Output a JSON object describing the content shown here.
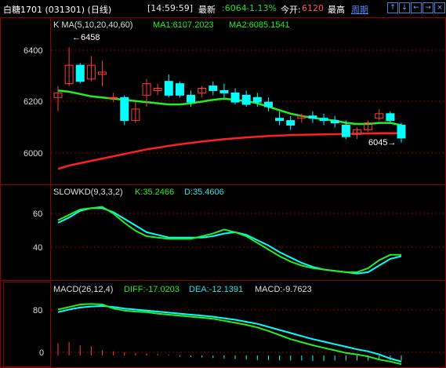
{
  "header": {
    "title": "白糖1701 (031301)  (日线)",
    "time": "[14:59:59]",
    "latest_label": "最新",
    "latest_value": ":6064",
    "change_pct": "-1.13%",
    "open_label": "今开:",
    "open_value": "6120",
    "high_label": "最高",
    "period_link": "周期",
    "nav_buttons": [
      "↑",
      "↓",
      "←",
      "→",
      "×"
    ]
  },
  "main_panel": {
    "indicator_title": "K  MA(5,10,20,40,60)",
    "ma1_text": "MA1:6107.2023",
    "ma2_text": "MA2:6085.1541",
    "y_ticks": [
      "6400",
      "6200",
      "6000"
    ],
    "high_annotation": "6458",
    "low_annotation": "6045"
  },
  "kd_panel": {
    "title": "SLOWKD(9,3,3,2)",
    "k_text": "K:35.2466",
    "d_text": "D:35.4606",
    "y_ticks": [
      "60",
      "40"
    ]
  },
  "macd_panel": {
    "title": "MACD(26,12,4)",
    "diff_text": "DIFF:-17.0203",
    "dea_text": "DEA:-12.1391",
    "macd_text": "MACD:-9.7623",
    "y_ticks": [
      "80",
      "0"
    ]
  },
  "colors": {
    "up": "#ff3c3c",
    "down": "#00ffff",
    "ma_green": "#22ee22",
    "ma_red": "#ff2020",
    "ma_magenta": "#ff22ff",
    "grid": "#8b0000",
    "axis_text": "#dddddd",
    "header_green": "#22dd22"
  },
  "chart_data": {
    "type": "candlestick",
    "candles": [
      {
        "o": 6240,
        "h": 6290,
        "l": 6180,
        "c": 6260
      },
      {
        "o": 6300,
        "h": 6458,
        "l": 6290,
        "c": 6380
      },
      {
        "o": 6380,
        "h": 6390,
        "l": 6300,
        "c": 6310
      },
      {
        "o": 6320,
        "h": 6420,
        "l": 6310,
        "c": 6380
      },
      {
        "o": 6340,
        "h": 6400,
        "l": 6290,
        "c": 6350
      },
      {
        "o": 6240,
        "h": 6260,
        "l": 6220,
        "c": 6240
      },
      {
        "o": 6240,
        "h": 6250,
        "l": 6120,
        "c": 6140
      },
      {
        "o": 6140,
        "h": 6220,
        "l": 6130,
        "c": 6190
      },
      {
        "o": 6250,
        "h": 6320,
        "l": 6200,
        "c": 6300
      },
      {
        "o": 6270,
        "h": 6300,
        "l": 6250,
        "c": 6280
      },
      {
        "o": 6310,
        "h": 6340,
        "l": 6240,
        "c": 6250
      },
      {
        "o": 6300,
        "h": 6310,
        "l": 6240,
        "c": 6250
      },
      {
        "o": 6250,
        "h": 6270,
        "l": 6200,
        "c": 6220
      },
      {
        "o": 6260,
        "h": 6290,
        "l": 6240,
        "c": 6280
      },
      {
        "o": 6290,
        "h": 6310,
        "l": 6250,
        "c": 6270
      },
      {
        "o": 6270,
        "h": 6300,
        "l": 6240,
        "c": 6260
      },
      {
        "o": 6260,
        "h": 6280,
        "l": 6210,
        "c": 6220
      },
      {
        "o": 6250,
        "h": 6270,
        "l": 6200,
        "c": 6210
      },
      {
        "o": 6240,
        "h": 6260,
        "l": 6200,
        "c": 6220
      },
      {
        "o": 6220,
        "h": 6240,
        "l": 6180,
        "c": 6200
      },
      {
        "o": 6150,
        "h": 6180,
        "l": 6120,
        "c": 6140
      },
      {
        "o": 6140,
        "h": 6160,
        "l": 6100,
        "c": 6120
      },
      {
        "o": 6150,
        "h": 6170,
        "l": 6130,
        "c": 6160
      },
      {
        "o": 6160,
        "h": 6180,
        "l": 6130,
        "c": 6150
      },
      {
        "o": 6150,
        "h": 6170,
        "l": 6120,
        "c": 6140
      },
      {
        "o": 6140,
        "h": 6160,
        "l": 6110,
        "c": 6130
      },
      {
        "o": 6120,
        "h": 6140,
        "l": 6060,
        "c": 6070
      },
      {
        "o": 6080,
        "h": 6110,
        "l": 6060,
        "c": 6100
      },
      {
        "o": 6100,
        "h": 6140,
        "l": 6090,
        "c": 6130
      },
      {
        "o": 6150,
        "h": 6190,
        "l": 6140,
        "c": 6170
      },
      {
        "o": 6170,
        "h": 6180,
        "l": 6130,
        "c": 6140
      },
      {
        "o": 6120,
        "h": 6130,
        "l": 6045,
        "c": 6064
      }
    ],
    "ma_green": [
      6270,
      6265,
      6255,
      6245,
      6240,
      6235,
      6230,
      6225,
      6220,
      6215,
      6210,
      6210,
      6215,
      6222,
      6230,
      6235,
      6230,
      6225,
      6215,
      6200,
      6185,
      6170,
      6160,
      6152,
      6145,
      6140,
      6130,
      6125,
      6125,
      6130,
      6130,
      6120
    ],
    "ma_red": [
      5930,
      5945,
      5955,
      5965,
      5975,
      5985,
      5995,
      6005,
      6015,
      6022,
      6030,
      6037,
      6043,
      6049,
      6054,
      6059,
      6063,
      6067,
      6070,
      6073,
      6075,
      6077,
      6078,
      6079,
      6080,
      6081,
      6082,
      6083,
      6084,
      6085,
      6085,
      6085
    ],
    "kd_k": [
      62,
      66,
      70,
      71,
      72,
      67,
      60,
      54,
      50,
      49,
      48,
      48,
      48,
      50,
      52,
      55,
      53,
      50,
      45,
      40,
      35,
      31,
      28,
      26,
      25,
      24,
      23,
      23,
      26,
      32,
      36,
      36
    ],
    "kd_d": [
      60,
      64,
      69,
      71,
      71,
      68,
      63,
      58,
      53,
      51,
      49,
      49,
      49,
      49,
      50,
      52,
      53,
      51,
      47,
      43,
      38,
      34,
      30,
      27,
      25,
      24,
      23,
      22,
      23,
      28,
      33,
      35
    ],
    "macd_diff": [
      90,
      95,
      100,
      101,
      100,
      92,
      88,
      86,
      85,
      82,
      80,
      78,
      76,
      74,
      72,
      68,
      64,
      60,
      55,
      48,
      40,
      32,
      26,
      20,
      15,
      10,
      5,
      2,
      -2,
      -8,
      -12,
      -17
    ],
    "macd_dea": [
      85,
      90,
      94,
      96,
      97,
      95,
      92,
      90,
      88,
      86,
      84,
      82,
      80,
      78,
      76,
      73,
      70,
      66,
      62,
      56,
      50,
      44,
      38,
      32,
      27,
      22,
      17,
      12,
      8,
      2,
      -6,
      -12
    ],
    "macd_hist": [
      24,
      26,
      20,
      18,
      10,
      8,
      6,
      5,
      4,
      3,
      2,
      -2,
      -3,
      -4,
      -5,
      -6,
      -7,
      -8,
      -9,
      -9,
      -10,
      -10,
      -10,
      -11,
      -11,
      -10,
      -10,
      -10,
      -10,
      -9,
      -9,
      -10
    ],
    "main_ylim": [
      5880,
      6520
    ],
    "kd_ylim": [
      20,
      80
    ],
    "macd_ylim": [
      -20,
      120
    ]
  }
}
